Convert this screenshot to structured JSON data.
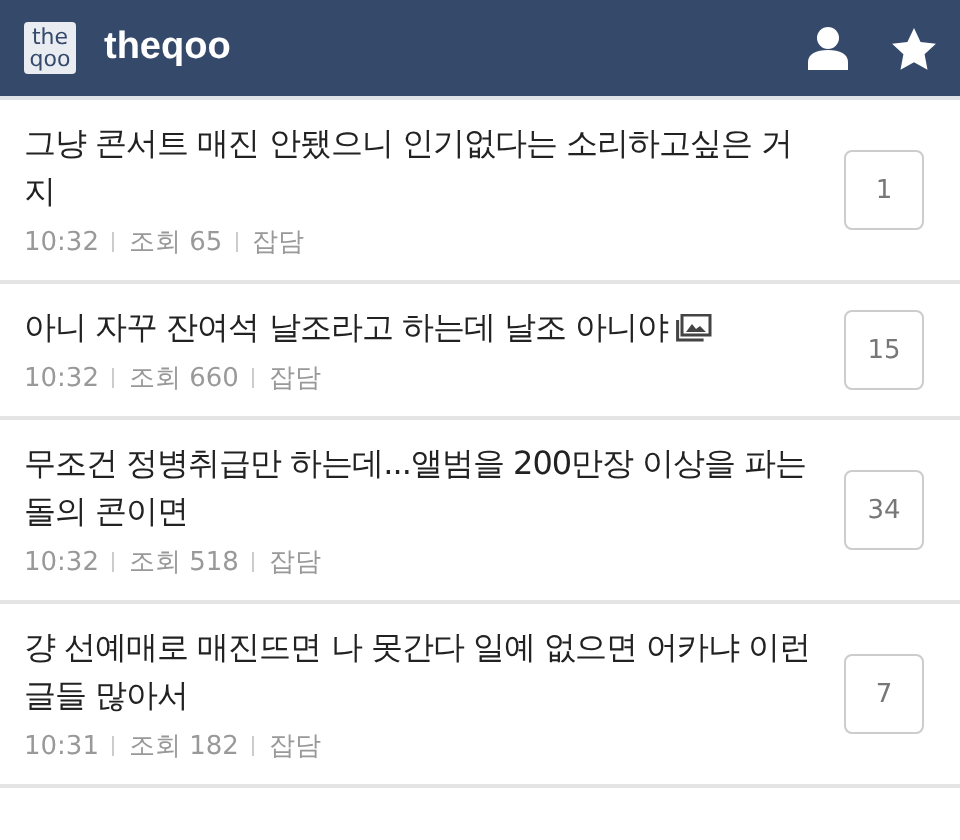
{
  "header": {
    "logo": "the qoo",
    "title": "theqoo"
  },
  "posts": [
    {
      "title": "그냥 콘서트 매진 안됐으니 인기없다는 소리하고싶은 거지",
      "has_image": false,
      "time": "10:32",
      "views": "조회 65",
      "category": "잡담",
      "comments": "1"
    },
    {
      "title": "아니 자꾸 잔여석 날조라고 하는데 날조 아니야",
      "has_image": true,
      "time": "10:32",
      "views": "조회 660",
      "category": "잡담",
      "comments": "15"
    },
    {
      "title": "무조건 정병취급만 하는데...앨범을 200만장 이상을 파는 돌의 콘이면",
      "has_image": false,
      "time": "10:32",
      "views": "조회 518",
      "category": "잡담",
      "comments": "34"
    },
    {
      "title": "걍 선예매로 매진뜨면 나 못간다 일예 없으면 어카냐 이런글들 많아서",
      "has_image": false,
      "time": "10:31",
      "views": "조회 182",
      "category": "잡담",
      "comments": "7"
    }
  ]
}
